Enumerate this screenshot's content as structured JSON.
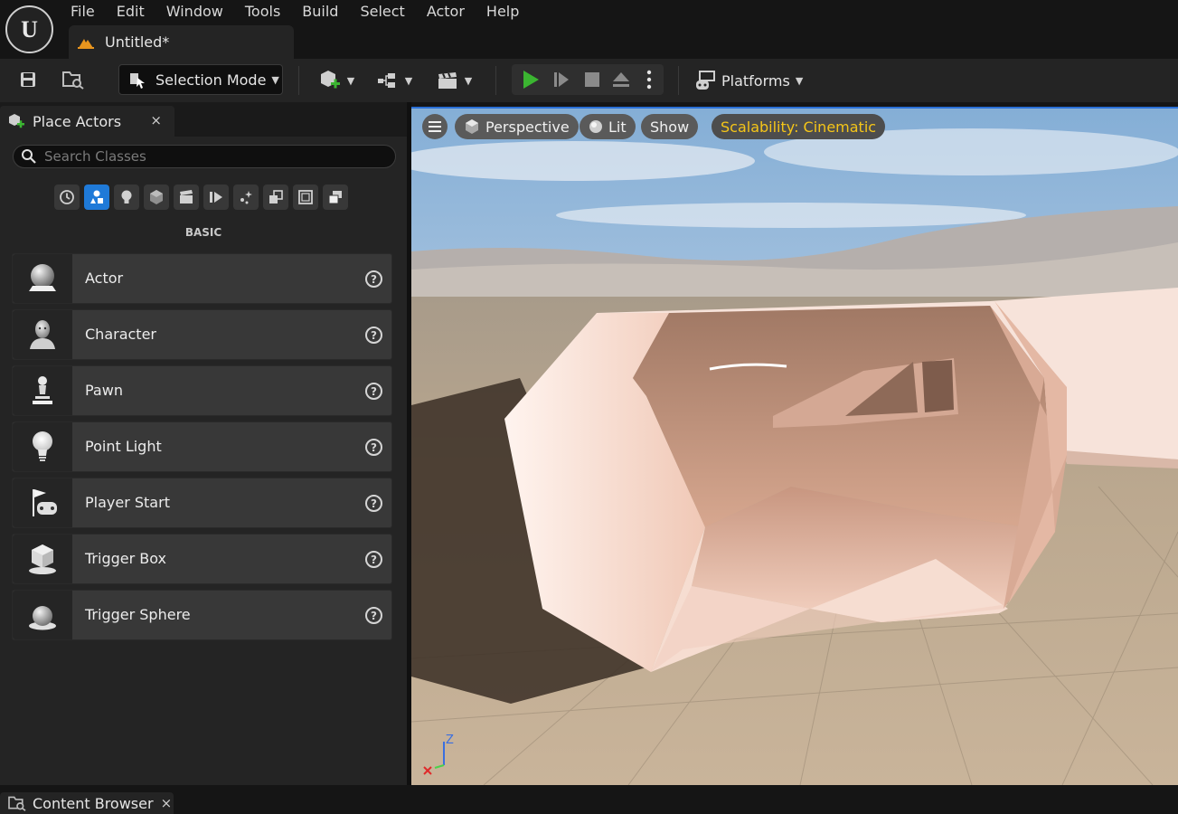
{
  "app": {
    "logo_text": "U"
  },
  "menu": [
    "File",
    "Edit",
    "Window",
    "Tools",
    "Build",
    "Select",
    "Actor",
    "Help"
  ],
  "document_tab": {
    "title": "Untitled*"
  },
  "toolbar": {
    "selection_mode": "Selection Mode",
    "platforms": "Platforms",
    "play_color": "#3bb531"
  },
  "place_actors": {
    "tab_title": "Place Actors",
    "close_glyph": "×",
    "search_placeholder": "Search Classes",
    "category_label": "BASIC",
    "categories": [
      "recent-icon",
      "basic-shapes-icon",
      "lights-icon",
      "cube-icon",
      "cinematic-icon",
      "visual-effects-icon",
      "effects-icon",
      "volumes-icon",
      "geometry-icon",
      "all-classes-icon"
    ],
    "active_category": 1,
    "items": [
      {
        "label": "Actor",
        "icon": "actor-sphere-icon"
      },
      {
        "label": "Character",
        "icon": "character-icon"
      },
      {
        "label": "Pawn",
        "icon": "pawn-icon"
      },
      {
        "label": "Point Light",
        "icon": "point-light-icon"
      },
      {
        "label": "Player Start",
        "icon": "player-start-icon"
      },
      {
        "label": "Trigger Box",
        "icon": "trigger-box-icon"
      },
      {
        "label": "Trigger Sphere",
        "icon": "trigger-sphere-icon"
      }
    ],
    "help_glyph": "?"
  },
  "viewport": {
    "perspective": "Perspective",
    "lit": "Lit",
    "show": "Show",
    "scalability": "Scalability: Cinematic",
    "axis_z": "Z"
  },
  "content_browser": {
    "tab_title": "Content Browser",
    "close_glyph": "×"
  }
}
